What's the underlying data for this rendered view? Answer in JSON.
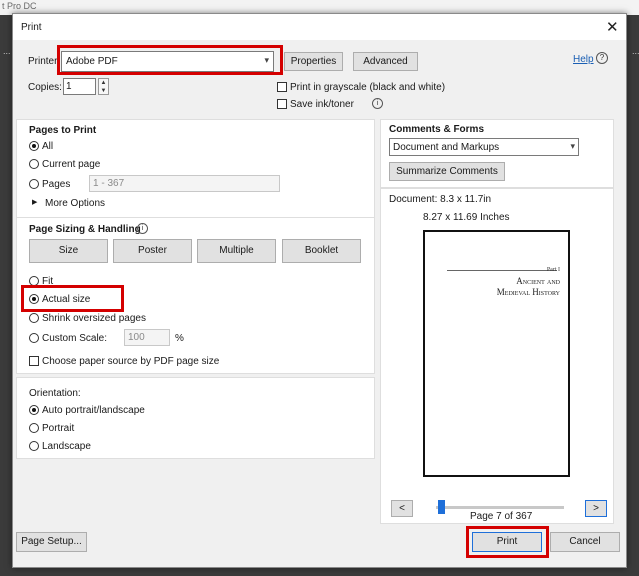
{
  "background": {
    "app_title": "t Pro DC",
    "left_dots": "...",
    "right_dots": "..."
  },
  "dialog": {
    "title": "Print",
    "close_glyph": "✕"
  },
  "top": {
    "printer_label": "Printer:",
    "printer_value": "Adobe PDF",
    "properties_label": "Properties",
    "advanced_label": "Advanced",
    "help_label": "Help",
    "copies_label": "Copies:",
    "copies_value": "1",
    "grayscale_label": "Print in grayscale (black and white)",
    "save_ink_label": "Save ink/toner"
  },
  "pages_to_print": {
    "heading": "Pages to Print",
    "all": "All",
    "current_page": "Current page",
    "pages": "Pages",
    "pages_value": "1 - 367",
    "more_options": "More Options"
  },
  "sizing": {
    "heading": "Page Sizing & Handling",
    "buttons": [
      "Size",
      "Poster",
      "Multiple",
      "Booklet"
    ],
    "fit": "Fit",
    "actual_size": "Actual size",
    "shrink": "Shrink oversized pages",
    "custom_scale": "Custom Scale:",
    "scale_value": "100",
    "percent": "%",
    "paper_source": "Choose paper source by PDF page size"
  },
  "orientation": {
    "heading": "Orientation:",
    "auto": "Auto portrait/landscape",
    "portrait": "Portrait",
    "landscape": "Landscape"
  },
  "comments": {
    "heading": "Comments & Forms",
    "select_value": "Document and Markups",
    "summarize": "Summarize Comments"
  },
  "preview": {
    "document_size": "Document: 8.3 x 11.7in",
    "paper_size": "8.27 x 11.69 Inches",
    "part_label": "Part I",
    "book_title_1": "Ancient and",
    "book_title_2": "Medieval History",
    "slider_fraction": 0.016,
    "page_indicator": "Page 7 of 367",
    "prev_glyph": "<",
    "next_glyph": ">"
  },
  "bottom": {
    "page_setup": "Page Setup...",
    "print": "Print",
    "cancel": "Cancel"
  },
  "colors": {
    "highlight": "#d40000",
    "link": "#1a5fb4",
    "slider_thumb": "#1e6fd9"
  }
}
